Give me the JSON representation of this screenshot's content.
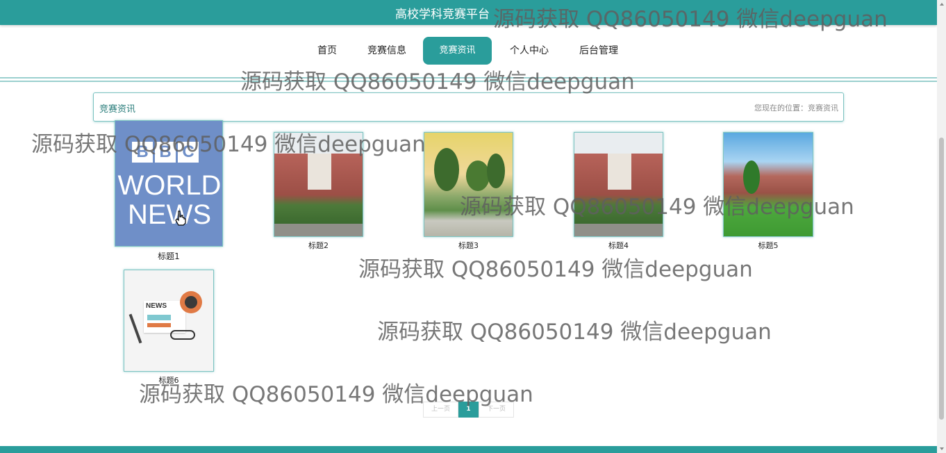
{
  "header": {
    "site_title": "高校学科竞赛平台"
  },
  "nav": {
    "items": [
      {
        "label": "首页"
      },
      {
        "label": "竞赛信息"
      },
      {
        "label": "竞赛资讯",
        "active": true
      },
      {
        "label": "个人中心"
      },
      {
        "label": "后台管理"
      }
    ]
  },
  "breadcrumb": {
    "title": "竞赛资讯",
    "location": "您现在的位置：竞赛资讯"
  },
  "news": [
    {
      "caption": "标题1",
      "image": "bbc-world-news"
    },
    {
      "caption": "标题2",
      "image": "campus-building"
    },
    {
      "caption": "标题3",
      "image": "campus-trees"
    },
    {
      "caption": "标题4",
      "image": "campus-building"
    },
    {
      "caption": "标题5",
      "image": "campus-lawn"
    },
    {
      "caption": "标题6",
      "image": "news-illustration"
    }
  ],
  "thumb_text": {
    "bbc": "BBC",
    "world": "WORLD",
    "news_line": "NEWS",
    "news_badge": "NEWS"
  },
  "pagination": {
    "prev": "上一页",
    "current": "1",
    "next": "下一页"
  },
  "watermark": "源码获取 QQ86050149 微信deepguan",
  "colors": {
    "primary": "#2a9d9b",
    "border": "#7cc3c1"
  }
}
